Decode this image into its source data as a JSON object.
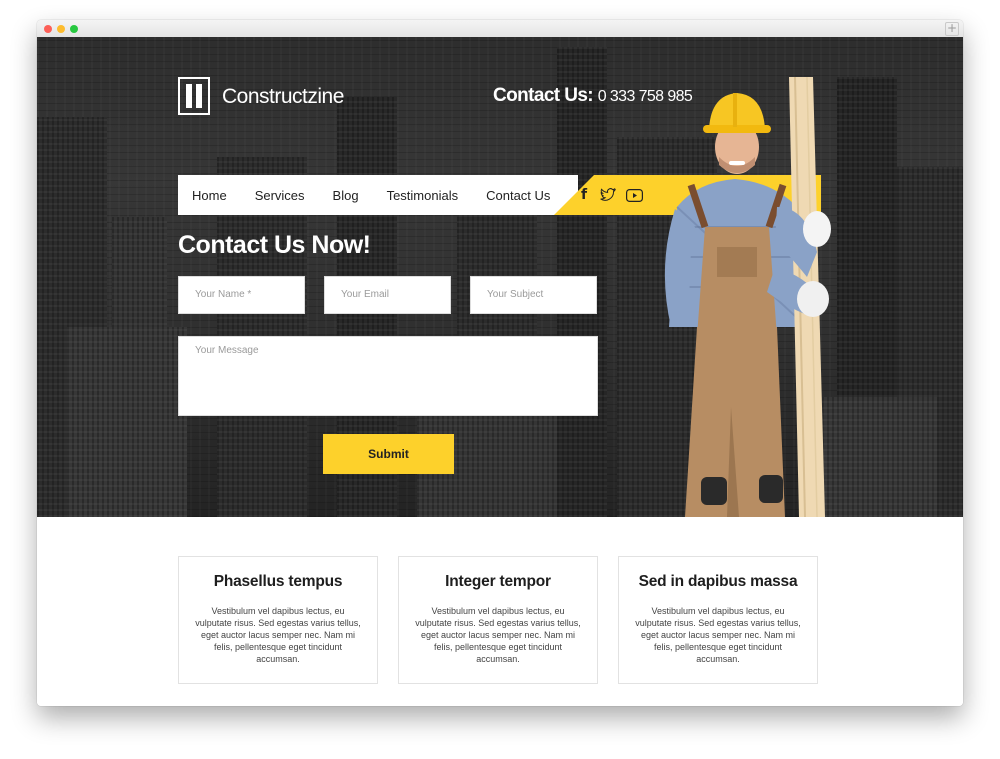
{
  "browser": {
    "new_tab": "+"
  },
  "header": {
    "brand": "Constructzine",
    "contact_label": "Contact Us:",
    "contact_phone": "0 333 758 985"
  },
  "nav": {
    "items": [
      "Home",
      "Services",
      "Blog",
      "Testimonials",
      "Contact Us"
    ],
    "social": [
      {
        "name": "facebook-icon",
        "glyph": "f"
      },
      {
        "name": "twitter-icon",
        "glyph": "🐦"
      },
      {
        "name": "youtube-icon",
        "glyph": "▶"
      }
    ]
  },
  "form": {
    "title": "Contact Us Now!",
    "name_placeholder": "Your Name *",
    "email_placeholder": "Your Email",
    "subject_placeholder": "Your Subject",
    "message_placeholder": "Your Message",
    "submit_label": "Submit"
  },
  "features": [
    {
      "title": "Phasellus tempus",
      "text": "Vestibulum vel dapibus lectus, eu vulputate risus. Sed egestas varius tellus, eget auctor lacus semper nec. Nam mi felis, pellentesque eget tincidunt accumsan."
    },
    {
      "title": "Integer tempor",
      "text": "Vestibulum vel dapibus lectus, eu vulputate risus. Sed egestas varius tellus, eget auctor lacus semper nec. Nam mi felis, pellentesque eget tincidunt accumsan."
    },
    {
      "title": "Sed in dapibus massa",
      "text": "Vestibulum vel dapibus lectus, eu vulputate risus. Sed egestas varius tellus, eget auctor lacus semper nec. Nam mi felis, pellentesque eget tincidunt accumsan."
    }
  ],
  "colors": {
    "accent": "#fdd12b",
    "hero_dark": "#3b3b3b",
    "text_dark": "#1e1e1e"
  }
}
